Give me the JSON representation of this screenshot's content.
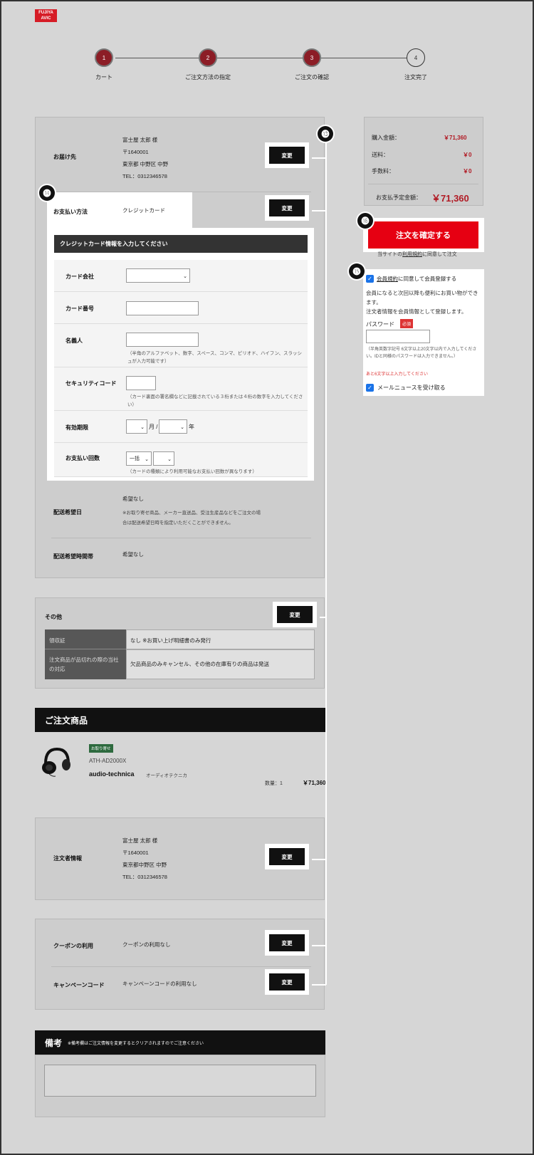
{
  "logo": {
    "line1": "FUJIYA",
    "line2": "AVIC"
  },
  "steps": [
    {
      "num": "1",
      "label": "カート"
    },
    {
      "num": "2",
      "label": "ご注文方法の指定"
    },
    {
      "num": "3",
      "label": "ご注文の確認"
    },
    {
      "num": "4",
      "label": "注文完了"
    }
  ],
  "markers": {
    "m13": "⓭",
    "m14": "⓮",
    "m15": "⓯",
    "m16": "⓰"
  },
  "delivery": {
    "label": "お届け先",
    "name": "富士屋 太郎 様",
    "zip": "〒1640001",
    "address": "東京都 中野区 中野",
    "tel": "TEL：0312346578",
    "change": "変更"
  },
  "payment": {
    "label": "お支払い方法",
    "value": "クレジットカード",
    "change": "変更"
  },
  "card": {
    "header": "クレジットカード情報を入力してください",
    "company_label": "カード会社",
    "number_label": "カード番号",
    "holder_label": "名義人",
    "holder_note": "（半角のアルファベット、数字、スペース、コンマ、ピリオド、ハイフン、スラッシュが入力可能です）",
    "security_label": "セキュリティコード",
    "security_note": "（カード裏面の署名欄などに記載されている３桁または４桁の数字を入力してください）",
    "expiry_label": "有効期限",
    "month_unit": "月 /",
    "year_unit": "年",
    "installments_label": "お支払い回数",
    "installments_value": "一括",
    "installments_note": "（カードの種類により利用可能なお支払い回数が異なります）"
  },
  "delivery_date": {
    "label": "配送希望日",
    "value": "希望なし",
    "note": "※お取り寄せ商品、メーカー直送品、受注生産品などをご注文の場合は配送希望日時を指定いただくことができません。"
  },
  "delivery_time": {
    "label": "配送希望時間帯",
    "value": "希望なし"
  },
  "other": {
    "title": "その他",
    "change": "変更",
    "rows": [
      {
        "label": "領収証",
        "value": "なし ※お買い上げ明細書のみ発行"
      },
      {
        "label": "注文商品が品切れの際の当社の対応",
        "value": "欠品商品のみキャンセル、その他の在庫有りの商品は発送"
      }
    ]
  },
  "items_section": {
    "title": "ご注文商品",
    "badge": "お取り寄せ",
    "model": "ATH-AD2000X",
    "brand": "audio-technica",
    "brand_kana": "オーディオテクニカ",
    "qty": "数量：1",
    "price": "￥71,360"
  },
  "orderer": {
    "label": "注文者情報",
    "name": "富士屋 太郎 様",
    "zip": "〒1640001",
    "address": "東京都中野区 中野",
    "tel": "TEL：0312346578",
    "change": "変更"
  },
  "coupon": {
    "label": "クーポンの利用",
    "value": "クーポンの利用なし",
    "change": "変更"
  },
  "campaign": {
    "label": "キャンペーンコード",
    "value": "キャンペーンコードの利用なし",
    "change": "変更"
  },
  "remarks": {
    "title": "備考",
    "note": "※備考欄はご注文情報を変更するとクリアされますのでご注意ください"
  },
  "summary": {
    "subtotal_label": "購入金額：",
    "subtotal": "￥71,360",
    "shipping_label": "送料：",
    "shipping": "￥0",
    "fee_label": "手数料：",
    "fee": "￥0",
    "total_label": "お支払予定金額：",
    "total": "￥71,360",
    "confirm": "注文を確定する",
    "terms_pre": "当サイトの",
    "terms_link": "利用規約",
    "terms_post": "に同意して注文"
  },
  "member": {
    "agree_link": "会員規約",
    "agree_text": "に同意して会員登録する",
    "desc1": "会員になると次回以降も便利にお買い物ができます。",
    "desc2": "注文者情報を会員情報として登録します。",
    "password_label": "パスワード",
    "required": "必須",
    "password_note": "（半角英数字記号 6文字以上20文字以内で入力してください。IDと同様のパスワードは入力できません。）",
    "password_error": "あと6文字以上入力してください",
    "newsletter": "メールニュースを受け取る"
  }
}
